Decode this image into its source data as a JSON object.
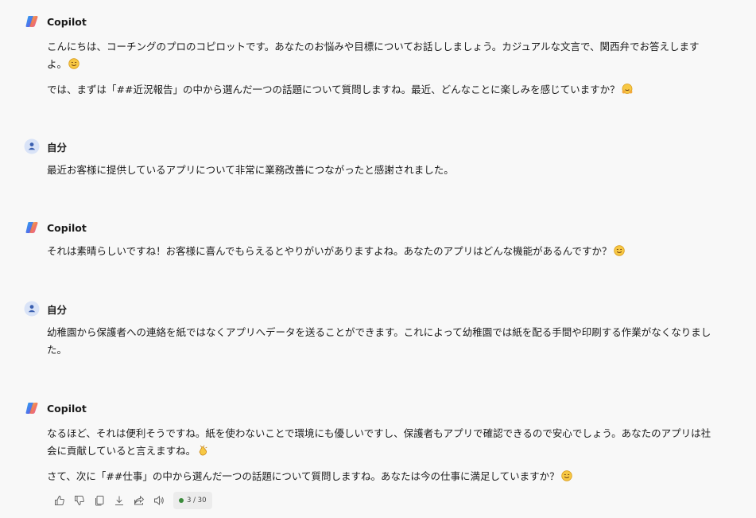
{
  "messages": [
    {
      "author": "Copilot",
      "role": "copilot",
      "paragraphs": [
        "こんにちは、コーチングのプロのコピロットです。あなたのお悩みや目標についてお話ししましょう。カジュアルな文言で、関西弁でお答えします",
        "よ。",
        "では、まずは「##近況報告」の中から選んだ一つの話題について質問しますね。最近、どんなことに楽しみを感じていますか？"
      ]
    },
    {
      "author": "自分",
      "role": "user",
      "paragraphs": [
        "最近お客様に提供しているアプリについて非常に業務改善につながったと感謝されました。"
      ]
    },
    {
      "author": "Copilot",
      "role": "copilot",
      "paragraphs": [
        "それは素晴らしいですね！お客様に喜んでもらえるとやりがいがありますよね。あなたのアプリはどんな機能があるんですか？"
      ]
    },
    {
      "author": "自分",
      "role": "user",
      "paragraphs": [
        "幼稚園から保護者への連絡を紙ではなくアプリへデータを送ることができます。これによって幼稚園では紙を配る手間や印刷する作業がなくなりまし",
        "た。"
      ]
    },
    {
      "author": "Copilot",
      "role": "copilot",
      "paragraphs": [
        "なるほど、それは便利そうですね。紙を使わないことで環境にも優しいですし、保護者もアプリで確認できるので安心でしょう。あなたのアプリは社",
        "会に貢献していると言えますね。",
        "さて、次に「##仕事」の中から選んだ一つの話題について質問しますね。あなたは今の仕事に満足していますか？"
      ]
    }
  ],
  "action_bar": {
    "icons": [
      "thumbs-up-icon",
      "thumbs-down-icon",
      "copy-icon",
      "download-icon",
      "share-icon",
      "read-aloud-icon"
    ],
    "counter": "3 / 30"
  },
  "colors": {
    "background": "#f8f8f8",
    "text": "#1b1b1b",
    "user_avatar": "#d9e3f7",
    "user_avatar_icon": "#3a5fb0",
    "counter_dot": "#3a8b3a"
  }
}
